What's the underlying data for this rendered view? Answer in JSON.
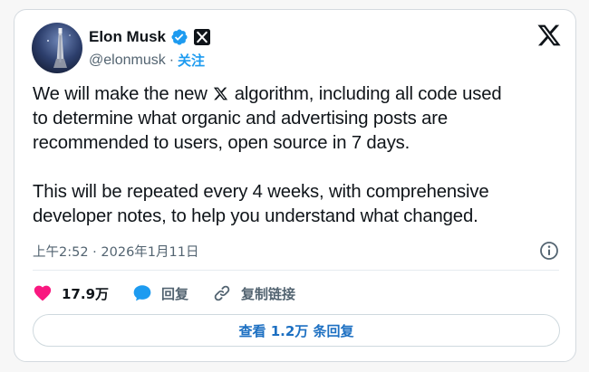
{
  "author": {
    "name": "Elon Musk",
    "handle": "@elonmusk",
    "separator": "·",
    "follow_label": "关注"
  },
  "tweet": {
    "paragraph1_before": "We will make the new ",
    "paragraph1_line1_after": " algorithm, including all code used",
    "paragraph1_line2": "to determine what organic and advertising posts are",
    "paragraph1_line3": "recommended to users, open source in 7 days.",
    "paragraph2_line1": "This will be repeated every 4 weeks, with comprehensive",
    "paragraph2_line2": "developer notes, to help you understand what changed."
  },
  "meta": {
    "timestamp": "上午2:52 · 2026年1月11日"
  },
  "actions": {
    "like_count": "17.9万",
    "reply_label": "回复",
    "copy_link_label": "复制链接"
  },
  "replies_button": {
    "label": "查看 1.2万 条回复"
  },
  "icons": {
    "verified": "verified-badge-icon",
    "affiliation": "x-affiliation-icon",
    "brand": "x-logo-icon",
    "info": "info-icon",
    "like": "heart-icon",
    "reply": "chat-bubble-icon",
    "link": "link-icon"
  },
  "colors": {
    "accent": "#1d9bf0",
    "like": "#f91880",
    "text": "#0f1419",
    "muted": "#536471"
  }
}
